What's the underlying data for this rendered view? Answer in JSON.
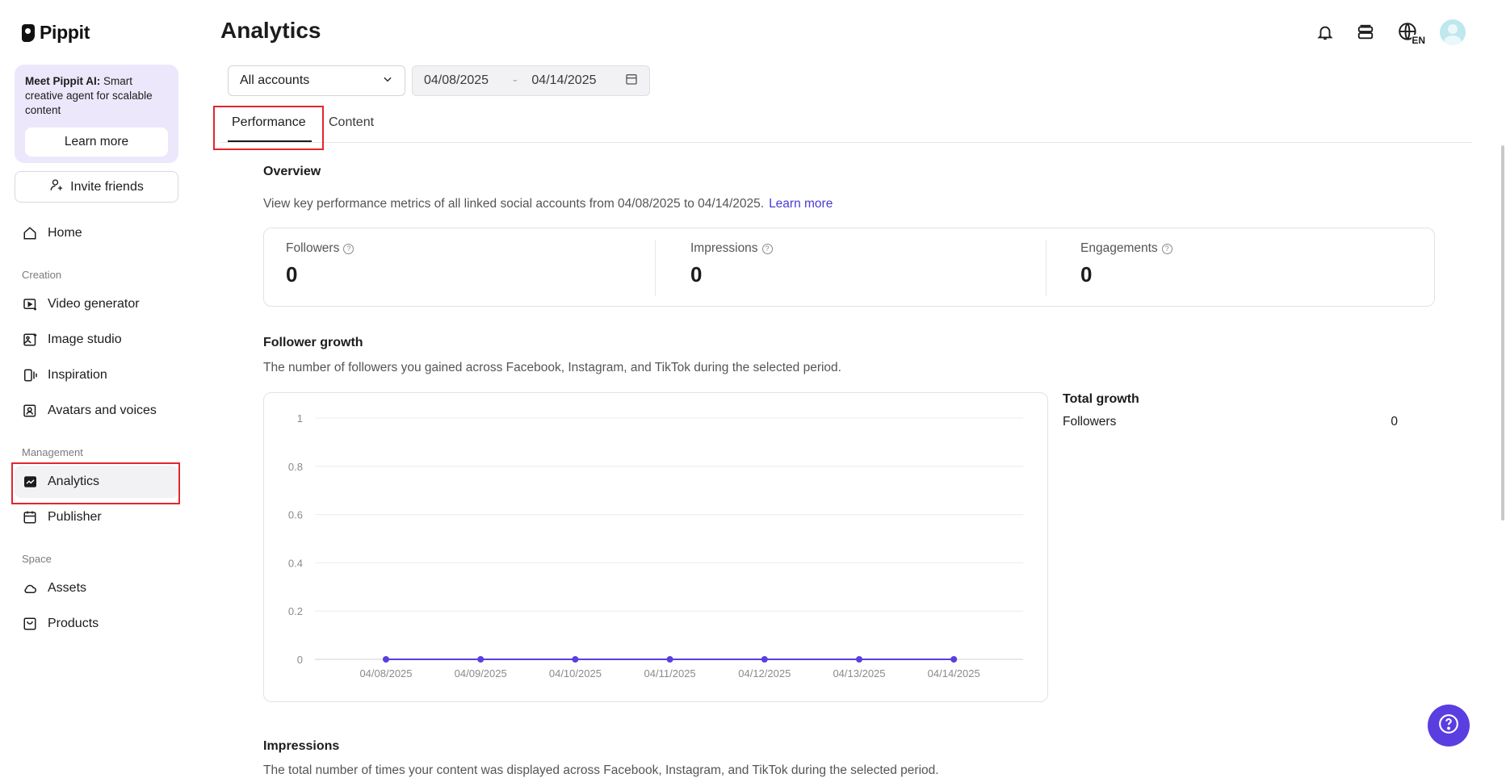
{
  "app": {
    "name": "Pippit"
  },
  "sidebar": {
    "promo": {
      "bold": "Meet Pippit AI:",
      "text": " Smart creative agent for scalable content",
      "button": "Learn more"
    },
    "invite": "Invite friends",
    "home": "Home",
    "sections": {
      "creation": "Creation",
      "management": "Management",
      "space": "Space"
    },
    "items": {
      "video_generator": "Video generator",
      "image_studio": "Image studio",
      "inspiration": "Inspiration",
      "avatars": "Avatars and voices",
      "analytics": "Analytics",
      "publisher": "Publisher",
      "assets": "Assets",
      "products": "Products"
    }
  },
  "header": {
    "title": "Analytics",
    "language": "EN"
  },
  "filters": {
    "account": "All accounts",
    "start_date": "04/08/2025",
    "end_date": "04/14/2025",
    "separator": "-"
  },
  "tabs": [
    {
      "label": "Performance",
      "active": true
    },
    {
      "label": "Content",
      "active": false
    }
  ],
  "overview": {
    "title": "Overview",
    "desc": "View key performance metrics of all linked social accounts from 04/08/2025 to 04/14/2025.",
    "link": "Learn more",
    "metrics": [
      {
        "label": "Followers",
        "value": "0"
      },
      {
        "label": "Impressions",
        "value": "0"
      },
      {
        "label": "Engagements",
        "value": "0"
      }
    ]
  },
  "follower_growth": {
    "title": "Follower growth",
    "desc": "The number of followers you gained across Facebook, Instagram, and TikTok during the selected period.",
    "total_title": "Total growth",
    "total_label": "Followers",
    "total_value": "0"
  },
  "impressions": {
    "title": "Impressions",
    "desc": "The total number of times your content was displayed across Facebook, Instagram, and TikTok during the selected period."
  },
  "chart_data": {
    "type": "line",
    "x": [
      "04/08/2025",
      "04/09/2025",
      "04/10/2025",
      "04/11/2025",
      "04/12/2025",
      "04/13/2025",
      "04/14/2025"
    ],
    "series": [
      {
        "values": [
          0,
          0,
          0,
          0,
          0,
          0,
          0
        ],
        "color": "#5a3ee0"
      }
    ],
    "yticks": [
      "0",
      "0.2",
      "0.4",
      "0.6",
      "0.8",
      "1"
    ],
    "ylim": [
      0,
      1
    ],
    "grid": true
  },
  "colors": {
    "accent": "#5a3ee0",
    "highlight": "#e3262c"
  }
}
